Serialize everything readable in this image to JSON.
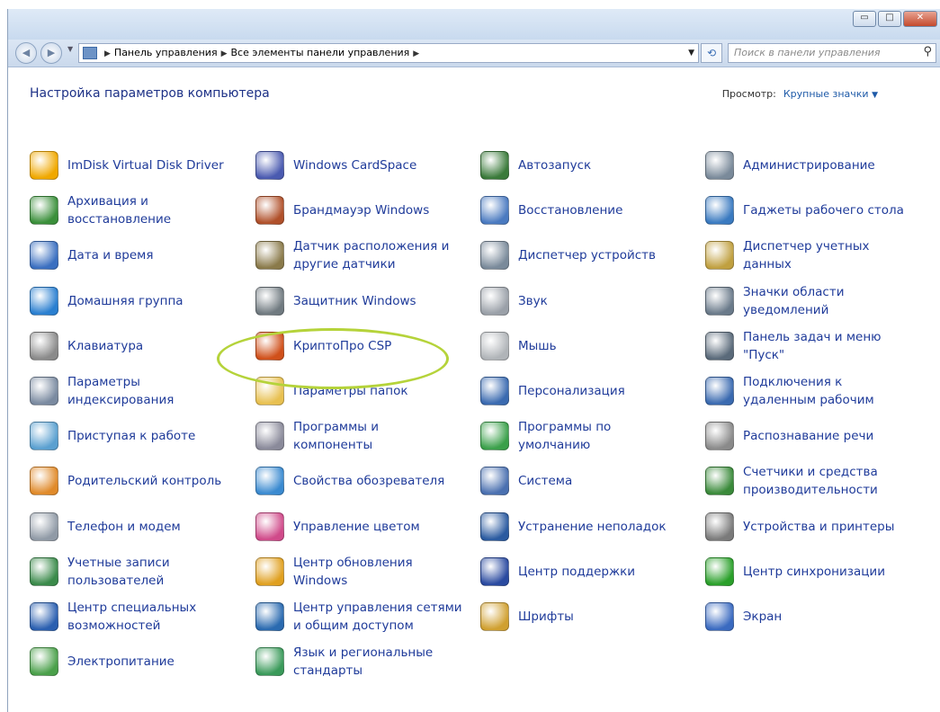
{
  "window": {
    "minimize_label": "▭",
    "maximize_label": "□",
    "close_label": "✕"
  },
  "address": {
    "crumbs": [
      "Панель управления",
      "Все элементы панели управления"
    ]
  },
  "search": {
    "placeholder": "Поиск в панели управления"
  },
  "heading": "Настройка параметров компьютера",
  "view": {
    "label": "Просмотр:",
    "value": "Крупные значки"
  },
  "items": [
    {
      "label": "ImDisk Virtual Disk Driver",
      "icon": "disk-icon",
      "color": "#f0a800"
    },
    {
      "label": "Архивация и\nвосстановление",
      "icon": "backup-icon",
      "color": "#3a8f3a"
    },
    {
      "label": "Дата и время",
      "icon": "calendar-clock-icon",
      "color": "#3a6fc0"
    },
    {
      "label": "Домашняя группа",
      "icon": "homegroup-icon",
      "color": "#2a7fd0"
    },
    {
      "label": "Клавиатура",
      "icon": "keyboard-icon",
      "color": "#8a8a8a"
    },
    {
      "label": "Параметры\nиндексирования",
      "icon": "indexing-icon",
      "color": "#7a8aa0"
    },
    {
      "label": "Приступая к работе",
      "icon": "getting-started-icon",
      "color": "#5aa0d0"
    },
    {
      "label": "Родительский контроль",
      "icon": "parental-control-icon",
      "color": "#e08a2a"
    },
    {
      "label": "Телефон и модем",
      "icon": "phone-icon",
      "color": "#909aa6"
    },
    {
      "label": "Учетные записи\nпользователей",
      "icon": "users-icon",
      "color": "#3a8a4a"
    },
    {
      "label": "Центр специальных\nвозможностей",
      "icon": "accessibility-icon",
      "color": "#2a5fb0"
    },
    {
      "label": "Электропитание",
      "icon": "power-icon",
      "color": "#4aa04a"
    },
    {
      "label": "Windows CardSpace",
      "icon": "cardspace-icon",
      "color": "#4a5ab0"
    },
    {
      "label": "Брандмауэр Windows",
      "icon": "firewall-icon",
      "color": "#b0502a"
    },
    {
      "label": "Датчик расположения и\nдругие датчики",
      "icon": "sensor-icon",
      "color": "#8a7a4a"
    },
    {
      "label": "Защитник Windows",
      "icon": "defender-icon",
      "color": "#707a80"
    },
    {
      "label": "КриптоПро CSP",
      "icon": "cryptopro-icon",
      "color": "#d0501a"
    },
    {
      "label": "Параметры папок",
      "icon": "folder-options-icon",
      "color": "#e8c050"
    },
    {
      "label": "Программы и\nкомпоненты",
      "icon": "programs-icon",
      "color": "#8a8a9a"
    },
    {
      "label": "Свойства обозревателя",
      "icon": "internet-options-icon",
      "color": "#3a8ad0"
    },
    {
      "label": "Управление цветом",
      "icon": "color-management-icon",
      "color": "#d04a8a"
    },
    {
      "label": "Центр обновления\nWindows",
      "icon": "windows-update-icon",
      "color": "#e0a020"
    },
    {
      "label": "Центр управления сетями\nи общим доступом",
      "icon": "network-center-icon",
      "color": "#2a6ab0"
    },
    {
      "label": "Язык и региональные\nстандарты",
      "icon": "region-icon",
      "color": "#3a9a5a"
    },
    {
      "label": "Автозапуск",
      "icon": "autoplay-icon",
      "color": "#3a7a3a"
    },
    {
      "label": "Восстановление",
      "icon": "recovery-icon",
      "color": "#4a7ac0"
    },
    {
      "label": "Диспетчер устройств",
      "icon": "device-manager-icon",
      "color": "#7a8a9a"
    },
    {
      "label": "Звук",
      "icon": "sound-icon",
      "color": "#9aa0a8"
    },
    {
      "label": "Мышь",
      "icon": "mouse-icon",
      "color": "#b0b4b8"
    },
    {
      "label": "Персонализация",
      "icon": "personalization-icon",
      "color": "#3a6ab0"
    },
    {
      "label": "Программы по\nумолчанию",
      "icon": "default-programs-icon",
      "color": "#3aa04a"
    },
    {
      "label": "Система",
      "icon": "system-icon",
      "color": "#4a70b0"
    },
    {
      "label": "Устранение неполадок",
      "icon": "troubleshooting-icon",
      "color": "#2a5aa0"
    },
    {
      "label": "Центр поддержки",
      "icon": "action-center-icon",
      "color": "#2a4aa0"
    },
    {
      "label": "Шрифты",
      "icon": "fonts-icon",
      "color": "#d0a030"
    },
    {
      "label": "Администрирование",
      "icon": "admin-tools-icon",
      "color": "#7a8a9a"
    },
    {
      "label": "Гаджеты рабочего стола",
      "icon": "gadgets-icon",
      "color": "#3a7ac0"
    },
    {
      "label": "Диспетчер учетных\nданных",
      "icon": "credential-manager-icon",
      "color": "#c0a040"
    },
    {
      "label": "Значки области\nуведомлений",
      "icon": "notification-icons-icon",
      "color": "#6a7a8a"
    },
    {
      "label": "Панель задач и меню\n\"Пуск\"",
      "icon": "taskbar-icon",
      "color": "#5a6a7a"
    },
    {
      "label": "Подключения к\nудаленным рабочим",
      "icon": "remote-desktop-icon",
      "color": "#3a6ab0"
    },
    {
      "label": "Распознавание речи",
      "icon": "microphone-icon",
      "color": "#8a8a8a"
    },
    {
      "label": "Счетчики и средства\nпроизводительности",
      "icon": "performance-icon",
      "color": "#3a8a3a"
    },
    {
      "label": "Устройства и принтеры",
      "icon": "printer-icon",
      "color": "#7a7a7a"
    },
    {
      "label": "Центр синхронизации",
      "icon": "sync-icon",
      "color": "#2aa02a"
    },
    {
      "label": "Экран",
      "icon": "display-icon",
      "color": "#3a6ac0"
    }
  ]
}
